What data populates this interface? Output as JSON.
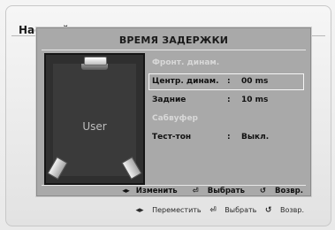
{
  "background": {
    "title": "Настройки",
    "footer": {
      "move_icon": "◂▸",
      "move_label": "Переместить",
      "select_icon": "⏎",
      "select_label": "Выбрать",
      "return_icon": "↺",
      "return_label": "Возвр."
    }
  },
  "dialog": {
    "title": "ВРЕМЯ ЗАДЕРЖКИ",
    "room_label": "User",
    "rows": [
      {
        "label": "Фронт. динам.",
        "sep": "",
        "value": "",
        "state": "disabled"
      },
      {
        "label": "Центр. динам.",
        "sep": ":",
        "value": "00 ms",
        "state": "selected"
      },
      {
        "label": "Задние",
        "sep": ":",
        "value": "10 ms",
        "state": "normal"
      },
      {
        "label": "Сабвуфер",
        "sep": "",
        "value": "",
        "state": "disabled"
      },
      {
        "label": "Тест-тон",
        "sep": ":",
        "value": "Выкл.",
        "state": "normal"
      }
    ],
    "footer": {
      "change_icon": "◂▸",
      "change_label": "Изменить",
      "select_icon": "⏎",
      "select_label": "Выбрать",
      "return_icon": "↺",
      "return_label": "Возвр."
    }
  },
  "colors": {
    "dialog_bg": "#a9a9a9",
    "room_bg": "#2f2f2f",
    "disabled_text": "#d8d8d8"
  }
}
